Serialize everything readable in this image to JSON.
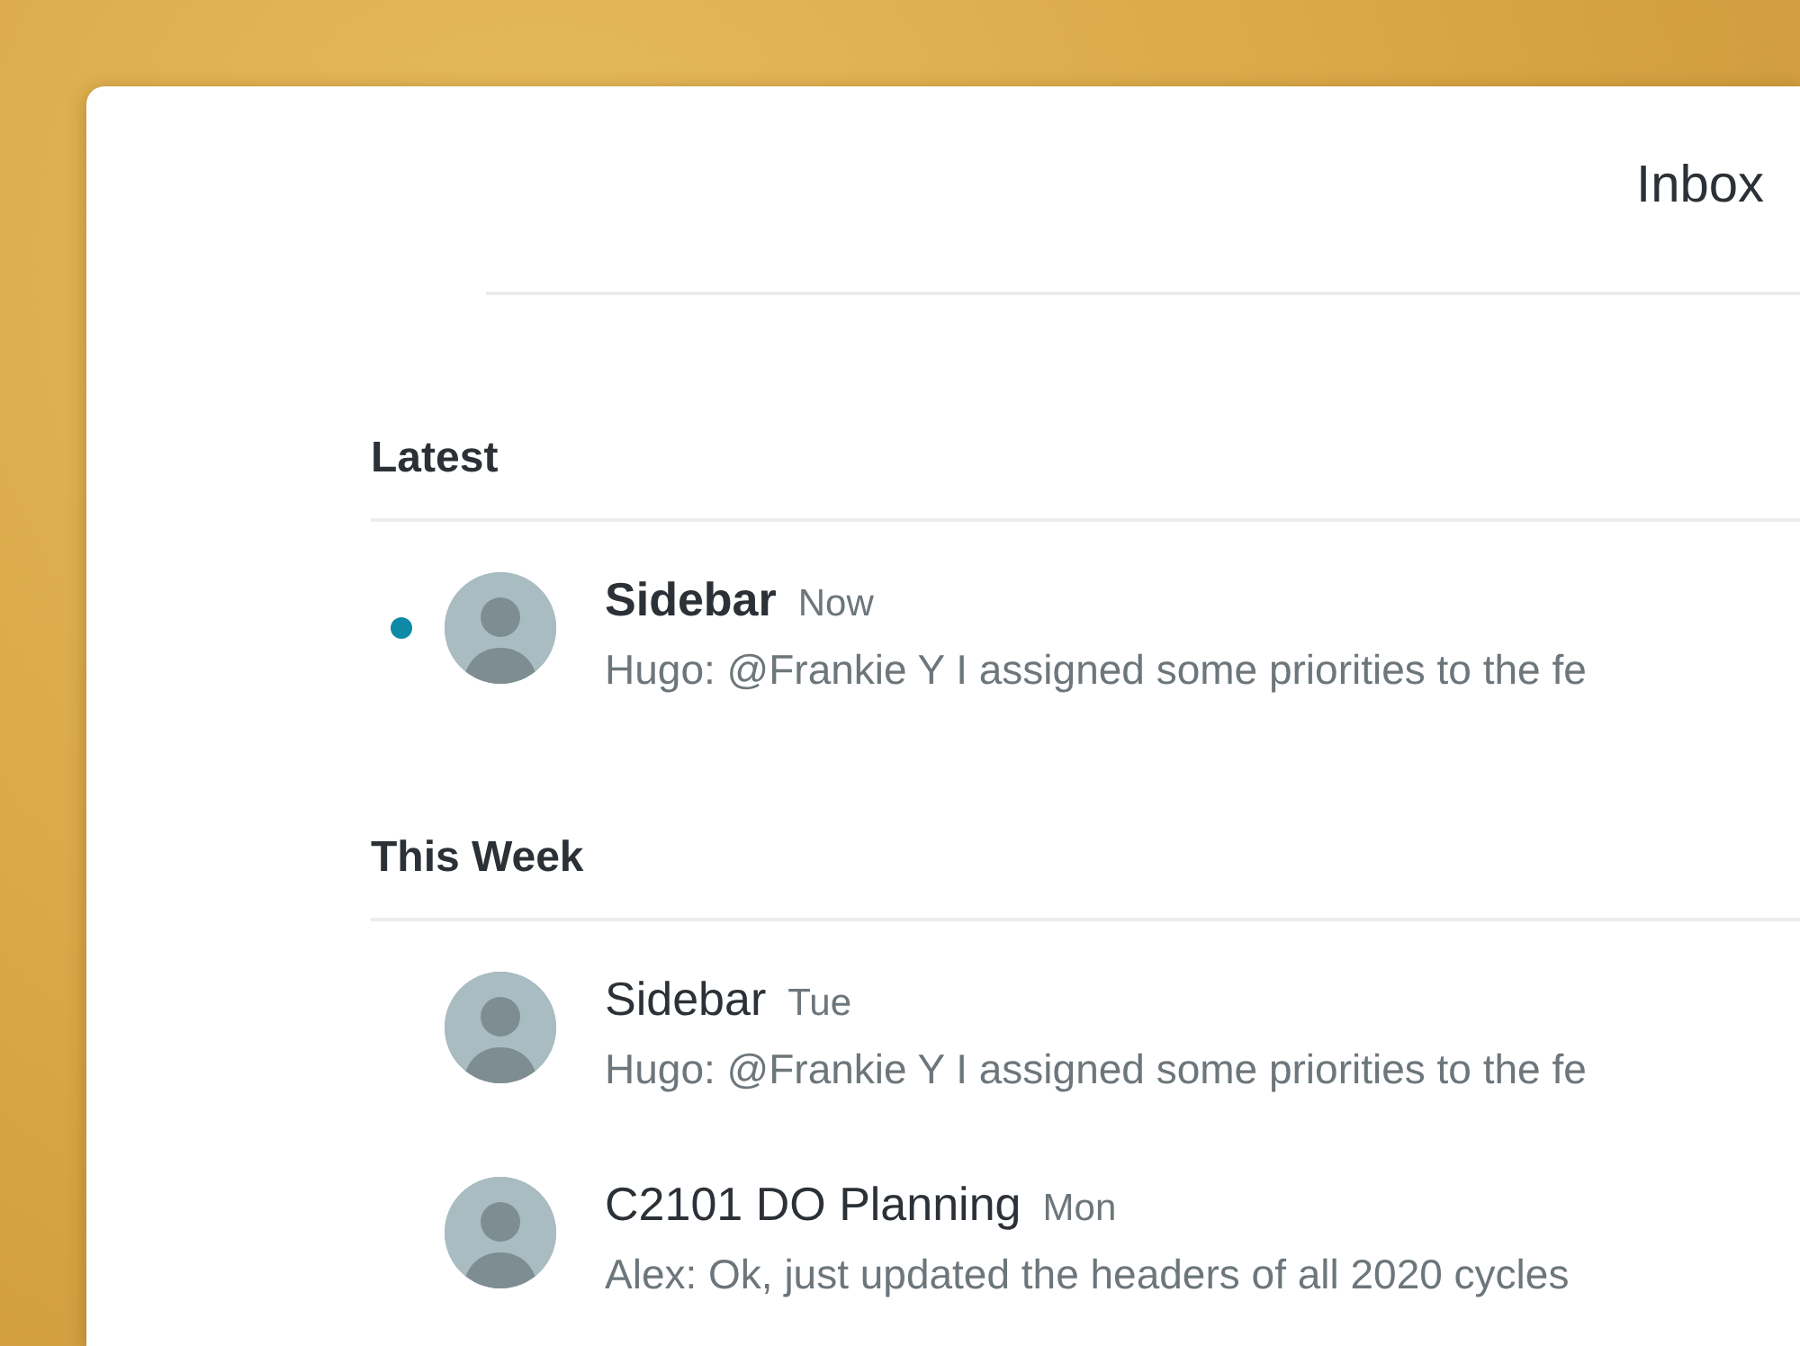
{
  "window": {
    "title": "Inbox"
  },
  "sections": [
    {
      "heading": "Latest",
      "items": [
        {
          "title": "Sidebar",
          "time": "Now",
          "preview": "Hugo: @Frankie Y I assigned some priorities to the fe",
          "unread": true
        }
      ]
    },
    {
      "heading": "This Week",
      "items": [
        {
          "title": "Sidebar",
          "time": "Tue",
          "preview": "Hugo: @Frankie Y I assigned some priorities to the fe",
          "unread": false
        },
        {
          "title": "C2101 DO Planning",
          "time": "Mon",
          "preview": "Alex: Ok, just updated the headers of all 2020 cycles",
          "unread": false
        }
      ]
    }
  ]
}
